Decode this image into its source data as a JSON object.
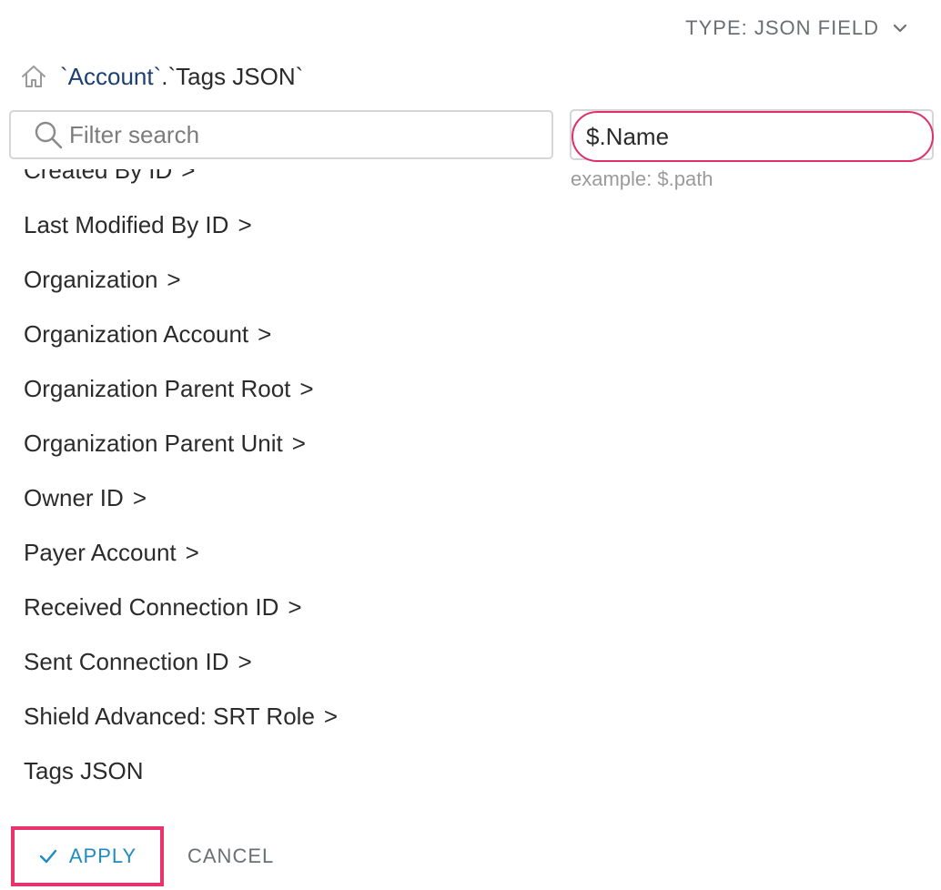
{
  "header": {
    "type_selector_label": "TYPE: JSON FIELD",
    "type_selector_icon": "chevron-down-icon"
  },
  "breadcrumb": {
    "home_icon": "home-icon",
    "link": "`Account`",
    "separator": ".",
    "current": "`Tags JSON`"
  },
  "search": {
    "icon": "search-icon",
    "placeholder": "Filter search",
    "value": ""
  },
  "path_input": {
    "value": "$.Name",
    "hint": "example: $.path",
    "focus_color": "#e0306a"
  },
  "fields": {
    "items": [
      {
        "label": "Created By ID",
        "arrow": ">"
      },
      {
        "label": "Last Modified By ID",
        "arrow": ">"
      },
      {
        "label": "Organization",
        "arrow": ">"
      },
      {
        "label": "Organization Account",
        "arrow": ">"
      },
      {
        "label": "Organization Parent Root",
        "arrow": ">"
      },
      {
        "label": "Organization Parent Unit",
        "arrow": ">"
      },
      {
        "label": "Owner ID",
        "arrow": ">"
      },
      {
        "label": "Payer Account",
        "arrow": ">"
      },
      {
        "label": "Received Connection ID",
        "arrow": ">"
      },
      {
        "label": "Sent Connection ID",
        "arrow": ">"
      },
      {
        "label": "Shield Advanced: SRT Role",
        "arrow": ">"
      },
      {
        "label": "Tags JSON",
        "arrow": ""
      }
    ]
  },
  "actions": {
    "apply_label": "APPLY",
    "apply_icon": "check-icon",
    "cancel_label": "CANCEL",
    "accent_color": "#1f8bc2",
    "highlight_color": "#e8336d"
  }
}
